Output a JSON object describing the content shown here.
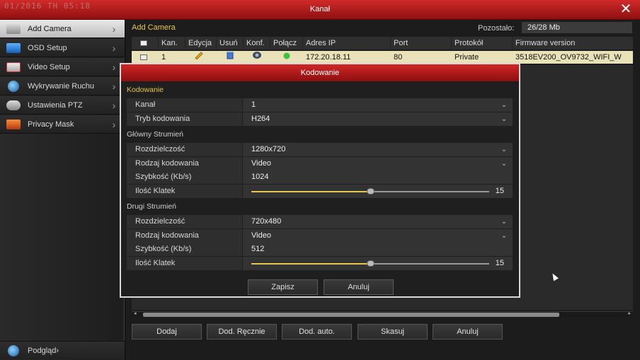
{
  "titlebar": {
    "osd_text": "01/2016 TH  05:18",
    "title": "Kanał",
    "close_label": "✕"
  },
  "sidebar": {
    "items": [
      {
        "label": "Add Camera",
        "icon": "camera-icon",
        "active": true
      },
      {
        "label": "OSD Setup",
        "icon": "osd-icon"
      },
      {
        "label": "Video Setup",
        "icon": "video-icon"
      },
      {
        "label": "Wykrywanie Ruchu",
        "icon": "motion-icon"
      },
      {
        "label": "Ustawienia PTZ",
        "icon": "ptz-icon"
      },
      {
        "label": "Privacy Mask",
        "icon": "privacy-icon"
      }
    ],
    "preview_label": "Podgląd",
    "chevron": "›"
  },
  "main": {
    "section_title": "Add Camera",
    "remaining_label": "Pozostało:",
    "remaining_value": "26/28 Mb",
    "columns": [
      "",
      "Kan.",
      "Edycja",
      "Usuń",
      "Konf.",
      "Połącz",
      "Adres IP",
      "Port",
      "Protokół",
      "Firmware version"
    ],
    "rows": [
      {
        "channel": "1",
        "ip": "172.20.18.11",
        "port": "80",
        "protocol": "Private",
        "firmware": "3518EV200_OV9732_WIFI_W"
      }
    ],
    "buttons": [
      "Dodaj",
      "Dod. Ręcznie",
      "Dod. auto.",
      "Skasuj",
      "Anuluj"
    ]
  },
  "modal": {
    "title": "Kodowanie",
    "group_encoding": "Kodowanie",
    "channel_label": "Kanał",
    "channel_value": "1",
    "mode_label": "Tryb kodowania",
    "mode_value": "H264",
    "main_stream": {
      "heading": "Główny Strumień",
      "resolution_label": "Rozdzielczość",
      "resolution_value": "1280x720",
      "type_label": "Rodzaj kodowania",
      "type_value": "Video",
      "bitrate_label": "Szybkość (Kb/s)",
      "bitrate_value": "1024",
      "fps_label": "Ilość Klatek",
      "fps_value": "15",
      "fps_fraction": 0.5
    },
    "sub_stream": {
      "heading": "Drugi Strumień",
      "resolution_label": "Rozdzielczość",
      "resolution_value": "720x480",
      "type_label": "Rodzaj kodowania",
      "type_value": "Video",
      "bitrate_label": "Szybkość (Kb/s)",
      "bitrate_value": "512",
      "fps_label": "Ilość Klatek",
      "fps_value": "15",
      "fps_fraction": 0.5
    },
    "save_label": "Zapisz",
    "cancel_label": "Anuluj",
    "dropdown_glyph": "⌄"
  }
}
